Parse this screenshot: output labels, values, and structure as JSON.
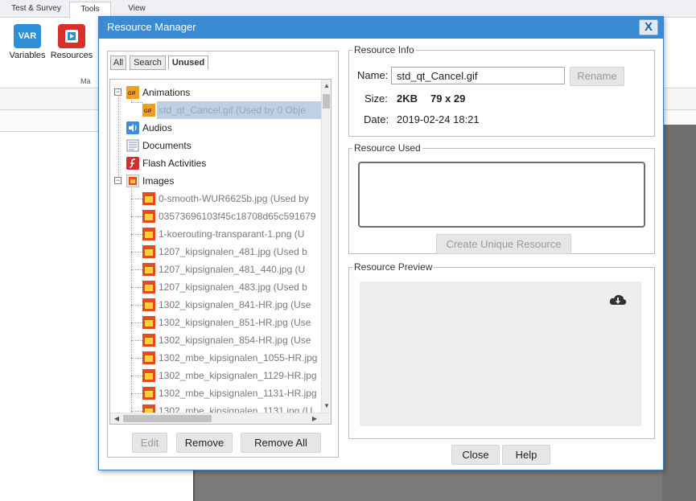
{
  "app": {
    "tabs": [
      "Test & Survey",
      "Tools",
      "View"
    ],
    "ribbon": {
      "buttons": [
        {
          "label": "Variables",
          "icon_text": "VAR",
          "icon": "variables-icon"
        },
        {
          "label": "Resources",
          "icon": "resources-icon"
        }
      ],
      "group_label": "Ma"
    }
  },
  "dialog": {
    "title": "Resource Manager",
    "close_glyph": "X",
    "tabs": [
      "All",
      "Search",
      "Unused"
    ],
    "active_tab": "Unused",
    "tree": {
      "folders": [
        {
          "label": "Animations",
          "expanded": true,
          "icon": "gif-folder-icon"
        },
        {
          "label": "Audios",
          "icon": "audio-icon"
        },
        {
          "label": "Documents",
          "icon": "document-icon"
        },
        {
          "label": "Flash Activities",
          "icon": "flash-icon"
        },
        {
          "label": "Images",
          "expanded": true,
          "icon": "image-folder-icon"
        }
      ],
      "animation_items": [
        {
          "label": "std_qt_Cancel.gif   (Used by 0 Obje",
          "selected": true
        }
      ],
      "image_items": [
        "0-smooth-WUR6625b.jpg   (Used by",
        "03573696103f45c18708d65c591679",
        "1-koerouting-transparant-1.png   (U",
        "1207_kipsignalen_481.jpg   (Used b",
        "1207_kipsignalen_481_440.jpg   (U",
        "1207_kipsignalen_483.jpg   (Used b",
        "1302_kipsignalen_841-HR.jpg   (Use",
        "1302_kipsignalen_851-HR.jpg   (Use",
        "1302_kipsignalen_854-HR.jpg   (Use",
        "1302_mbe_kipsignalen_1055-HR.jpg",
        "1302_mbe_kipsignalen_1129-HR.jpg",
        "1302_mbe_kipsignalen_1131-HR.jpg",
        "1302_mbe_kipsignalen_1131.jpg   (U"
      ]
    },
    "left_buttons": {
      "edit": "Edit",
      "remove": "Remove",
      "remove_all": "Remove All"
    },
    "resource_info": {
      "legend": "Resource Info",
      "name_label": "Name:",
      "name_value": "std_qt_Cancel.gif",
      "rename": "Rename",
      "size_label": "Size:",
      "size_value": "2KB",
      "dimensions": "79 x 29",
      "date_label": "Date:",
      "date_value": "2019-02-24 18:21"
    },
    "resource_used": {
      "legend": "Resource Used",
      "create_unique": "Create Unique Resource"
    },
    "resource_preview": {
      "legend": "Resource Preview",
      "icon": "cloud-download-icon"
    },
    "bottom_buttons": {
      "close": "Close",
      "help": "Help"
    }
  },
  "colors": {
    "titlebar": "#3b8ad4",
    "selection": "#bfcfe6",
    "workspace": "#7a7a7a"
  }
}
